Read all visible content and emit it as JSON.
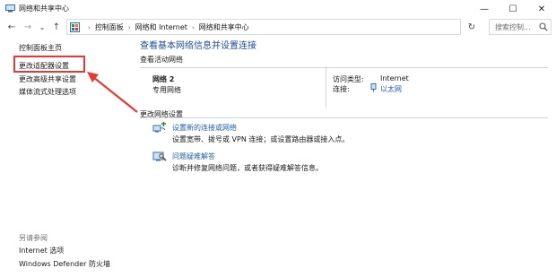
{
  "window": {
    "title": "网络和共享中心",
    "minimize_glyph": "—",
    "maximize_glyph": "☐",
    "close_glyph": "✕"
  },
  "nav": {
    "back_glyph": "←",
    "forward_glyph": "→",
    "recent_glyph": "⌄",
    "up_glyph": "↑",
    "refresh_glyph": "↻",
    "dropdown_glyph": "⌄"
  },
  "address": {
    "sep_glyph": "›",
    "crumbs": [
      "控制面板",
      "网络和 Internet",
      "网络和共享中心"
    ]
  },
  "search": {
    "placeholder": "搜索控制..."
  },
  "sidebar": {
    "links": [
      "控制面板主页",
      "更改适配器设置",
      "更改高级共享设置",
      "媒体流式处理选项"
    ],
    "see_also_title": "另请参阅",
    "see_also_links": [
      "Internet 选项",
      "Windows Defender 防火墙"
    ]
  },
  "main": {
    "title": "查看基本网络信息并设置连接",
    "active_networks_header": "查看活动网络",
    "network": {
      "name": "网络 2",
      "type": "专用网络",
      "access_type_label": "访问类型:",
      "access_type_value": "Internet",
      "connections_label": "连接:",
      "connection_name": "以太网"
    },
    "change_settings_header": "更改网络设置",
    "tasks": [
      {
        "icon": "new-connection-icon",
        "link": "设置新的连接或网络",
        "desc": "设置宽带、拨号或 VPN 连接；或设置路由器或接入点。"
      },
      {
        "icon": "troubleshoot-icon",
        "link": "问题疑难解答",
        "desc": "诊断并修复网络问题，或者获得疑难解答信息。"
      }
    ]
  },
  "colors": {
    "accent_link": "#1f5ea8",
    "title_blue": "#1f4e96",
    "highlight_red": "#e53935"
  }
}
